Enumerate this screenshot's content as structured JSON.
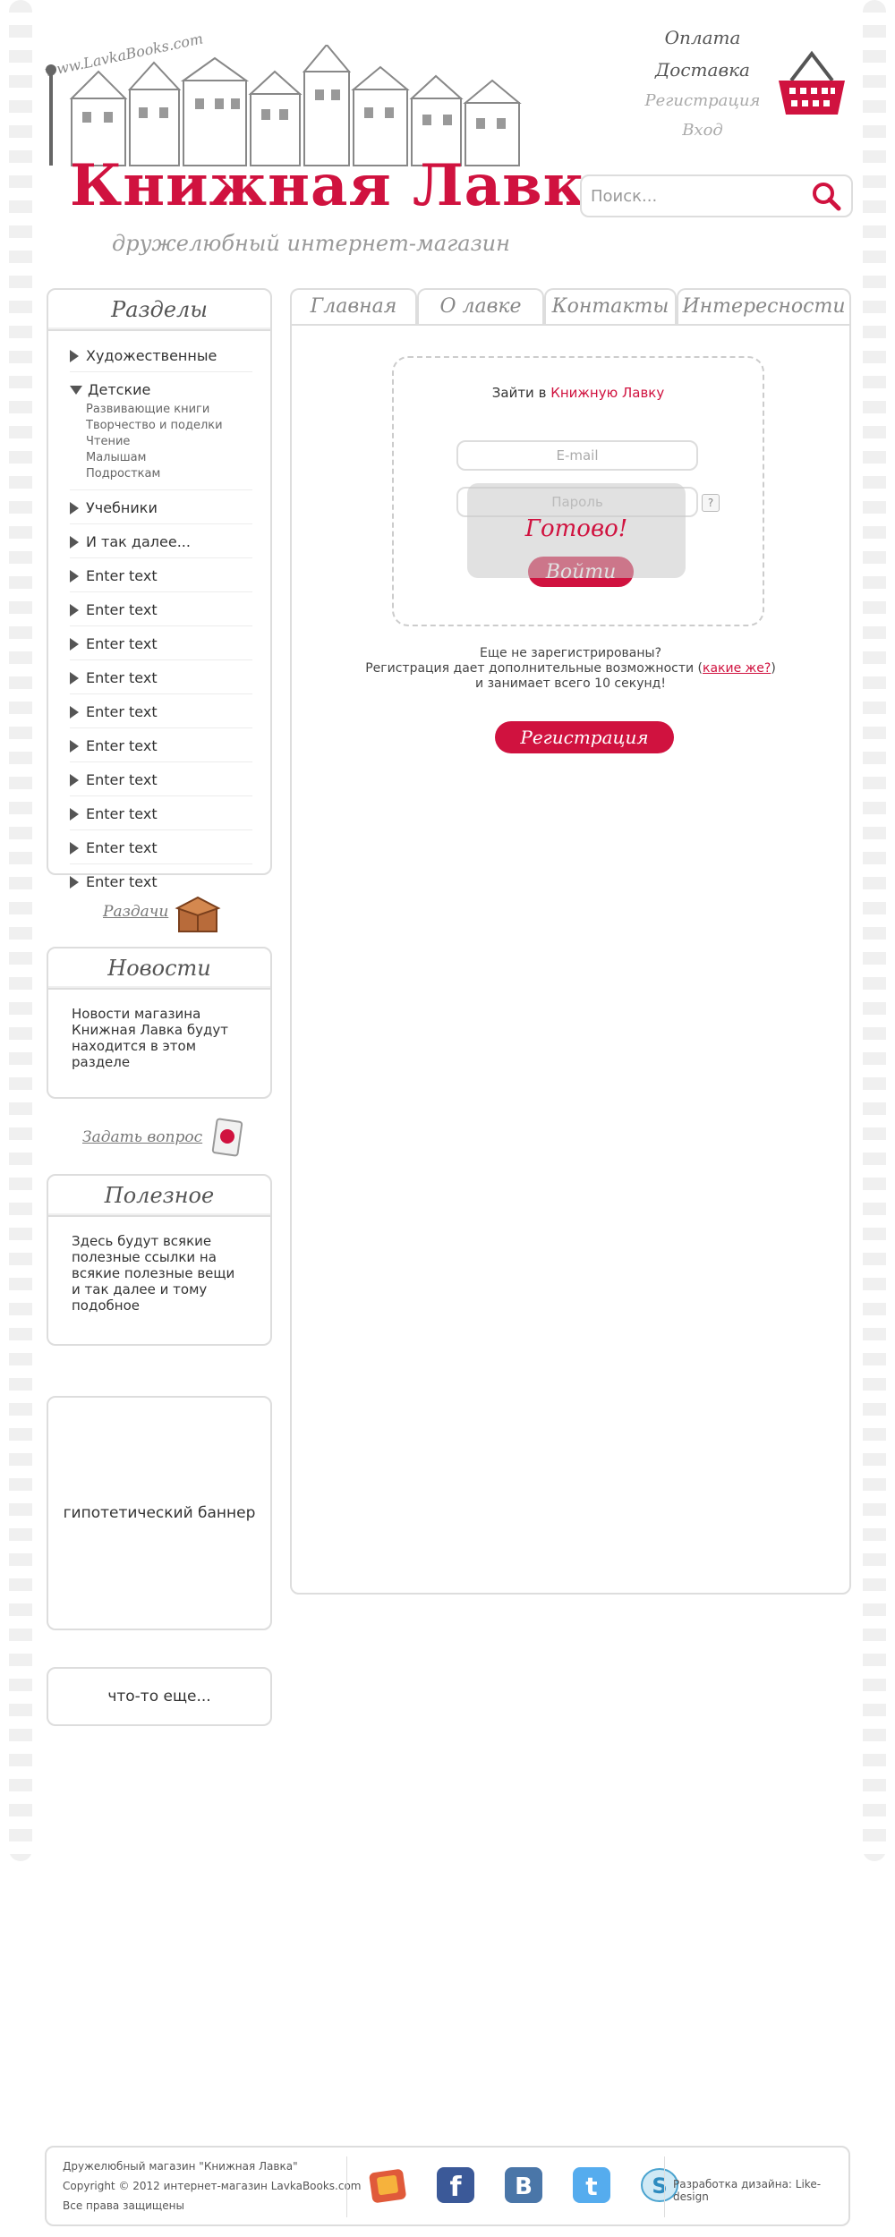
{
  "header": {
    "url_text": "www.LavkaBooks.com",
    "logo_title": "Книжная Лавка",
    "tagline": "дружелюбный интернет-магазин",
    "nav": [
      "Оплата",
      "Доставка",
      "Регистрация",
      "Вход"
    ],
    "search_placeholder": "Поиск...",
    "icons": {
      "cart": "basket-icon",
      "search": "magnifier-icon"
    }
  },
  "sidebar": {
    "sections_title": "Разделы",
    "categories": [
      {
        "label": "Художественные"
      },
      {
        "label": "Детские",
        "sub": [
          "Развивающие книги",
          "Творчество и поделки",
          "Чтение",
          "Малышам",
          "Подросткам"
        ]
      },
      {
        "label": "Учебники"
      },
      {
        "label": "И так далее..."
      },
      {
        "label": "Enter text"
      },
      {
        "label": "Enter text"
      },
      {
        "label": "Enter text"
      },
      {
        "label": "Enter text"
      },
      {
        "label": "Enter text"
      },
      {
        "label": "Enter text"
      },
      {
        "label": "Enter text"
      },
      {
        "label": "Enter text"
      },
      {
        "label": "Enter text"
      },
      {
        "label": "Enter text"
      }
    ],
    "giveaways_label": "Раздачи",
    "news_title": "Новости",
    "news_text": "Новости магазина Книжная Лавка будут находится в этом разделе",
    "ask_label": "Задать вопрос",
    "useful_title": "Полезное",
    "useful_text": "Здесь будут всякие полезные ссылки на всякие полезные вещи и так далее и тому подобное",
    "banner_text": "гипотетический баннер",
    "more_text": "что-то еще..."
  },
  "tabs": [
    "Главная",
    "О лавке",
    "Контакты",
    "Интересности"
  ],
  "login": {
    "title_prefix": "Зайти в ",
    "title_accent": "Книжную Лавку",
    "email_placeholder": "E-mail",
    "password_placeholder": "Пароль",
    "help": "?",
    "button": "Войти",
    "overlay": "Готово!"
  },
  "registration": {
    "line1": "Еще не зарегистрированы?",
    "line2_before": "Регистрация дает дополнительные возможности (",
    "line2_link": "какие же?",
    "line2_after": ")",
    "line3": "и занимает всего 10 секунд!",
    "button": "Регистрация"
  },
  "footer": {
    "line1": "Дружелюбный магазин \"Книжная Лавка\"",
    "line2": "Copyright © 2012 интернет-магазин LavkaBooks.com",
    "line3": "Все права защищены",
    "credit": "Разработка дизайна: Like-design",
    "socials": [
      "odnoklassniki-icon",
      "facebook-icon",
      "vkontakte-icon",
      "twitter-icon",
      "skype-icon"
    ]
  },
  "colors": {
    "accent": "#d0123f",
    "border": "#dddddd",
    "muted": "#999999"
  }
}
